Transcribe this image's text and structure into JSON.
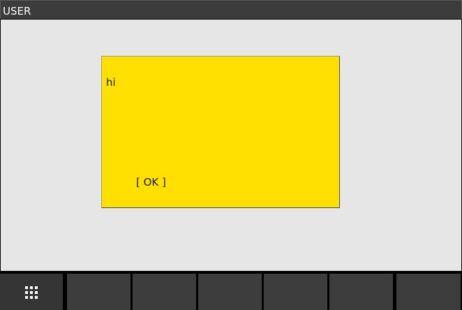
{
  "window": {
    "title": "USER"
  },
  "dialog": {
    "message": "hi",
    "ok_label": "[ OK ]",
    "background_color": "#ffe000"
  },
  "softkeys": {
    "menu_icon": "grid-icon",
    "count": 7
  },
  "colors": {
    "title_bar": "#3c3c3c",
    "content_background": "#e6e6e6",
    "softkey": "#3d3d3d"
  }
}
